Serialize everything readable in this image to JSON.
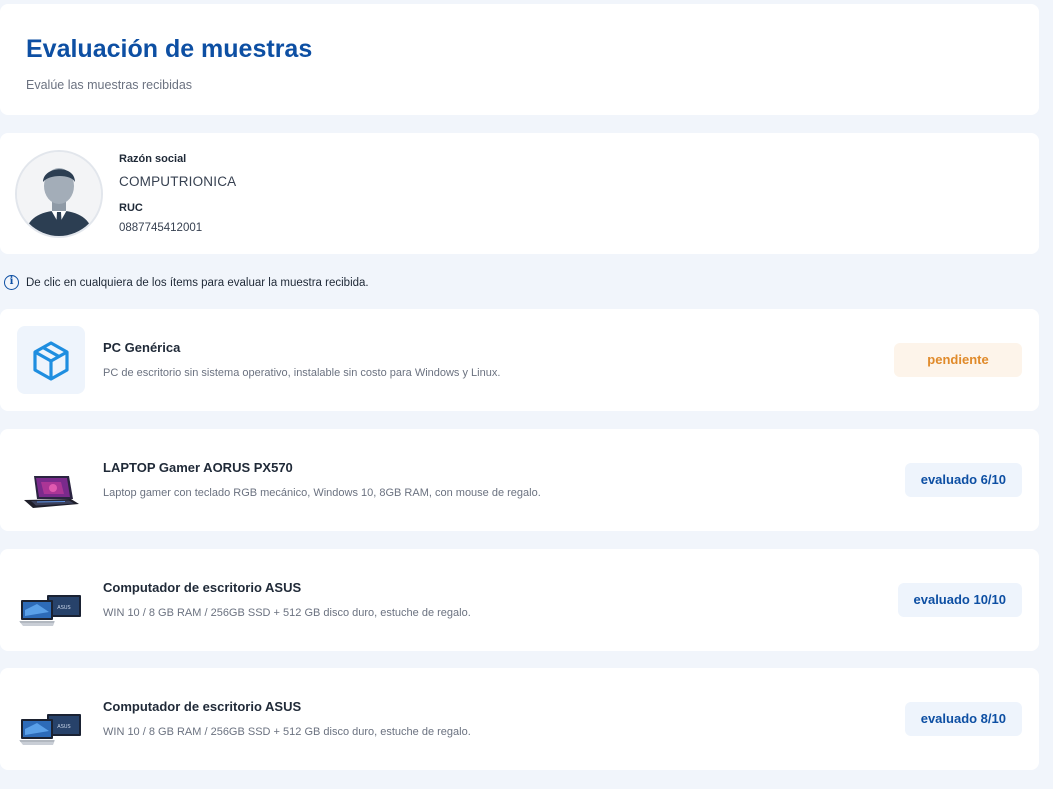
{
  "header": {
    "title": "Evaluación de muestras",
    "subtitle": "Evalúe las muestras recibidas"
  },
  "supplier": {
    "razon_label": "Razón social",
    "razon_value": "COMPUTRIONICA",
    "ruc_label": "RUC",
    "ruc_value": "0887745412001"
  },
  "info": {
    "icon": "info-icon",
    "text": "De clic en cualquiera de los ítems para evaluar la muestra recibida."
  },
  "items": [
    {
      "title": "PC Genérica",
      "description": "PC de escritorio sin sistema operativo, instalable sin costo para Windows y Linux.",
      "status": "pendiente",
      "thumb": "box-icon"
    },
    {
      "title": "LAPTOP Gamer AORUS PX570",
      "description": "Laptop gamer con teclado RGB mecánico, Windows 10, 8GB RAM, con mouse de regalo.",
      "status": "evaluado 6/10",
      "thumb": "laptop-gamer-image"
    },
    {
      "title": "Computador de escritorio ASUS",
      "description": "WIN 10 / 8 GB RAM / 256GB SSD + 512 GB disco duro, estuche de regalo.",
      "status": "evaluado 10/10",
      "thumb": "asus-desktop-image"
    },
    {
      "title": "Computador de escritorio ASUS",
      "description": "WIN 10 / 8 GB RAM / 256GB SSD + 512 GB disco duro, estuche de regalo.",
      "status": "evaluado 8/10",
      "thumb": "asus-desktop-image"
    }
  ],
  "colors": {
    "brand": "#0d4fa3",
    "pending": "#e08a2a",
    "background": "#f1f5fb"
  }
}
